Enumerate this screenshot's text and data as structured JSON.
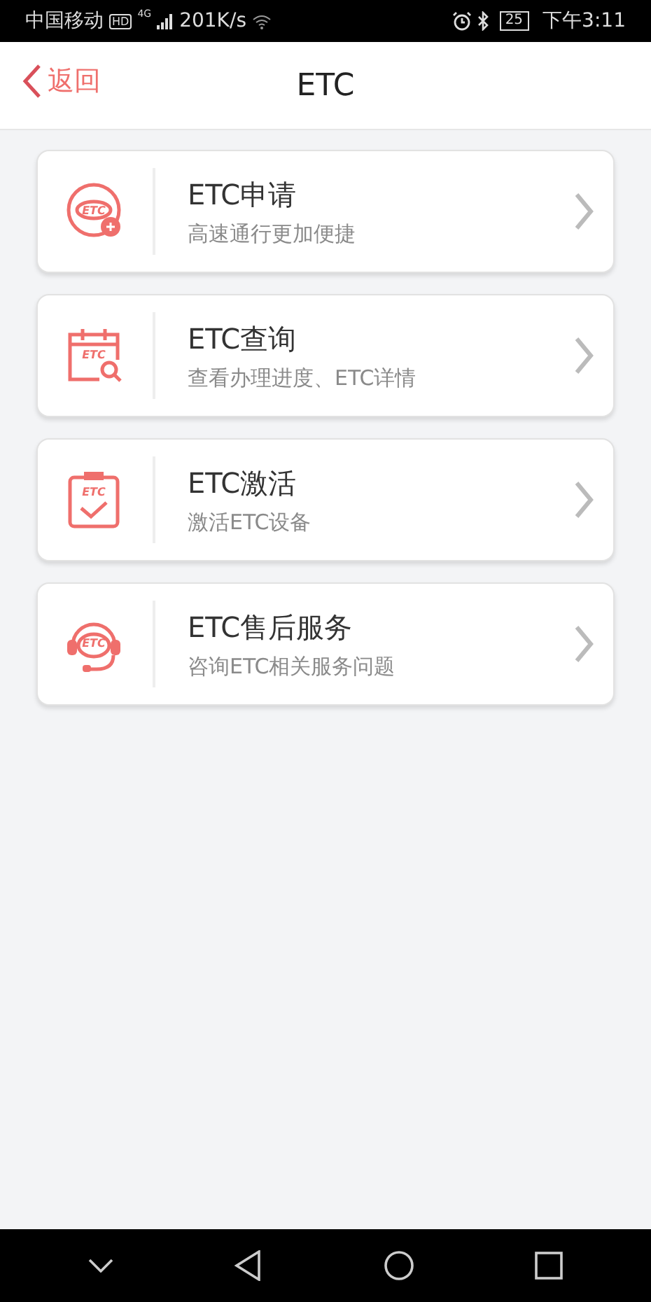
{
  "status_bar": {
    "carrier": "中国移动",
    "hd": "HD",
    "network": "4G",
    "speed": "201K/s",
    "battery": "25",
    "time": "下午3:11"
  },
  "header": {
    "back": "返回",
    "title": "ETC"
  },
  "items": [
    {
      "kind": "apply",
      "icon_label": "ETC",
      "title": "ETC申请",
      "subtitle": "高速通行更加便捷"
    },
    {
      "kind": "query",
      "icon_label": "ETC",
      "title": "ETC查询",
      "subtitle": "查看办理进度、ETC详情"
    },
    {
      "kind": "activate",
      "icon_label": "ETC",
      "title": "ETC激活",
      "subtitle": "激活ETC设备"
    },
    {
      "kind": "service",
      "icon_label": "ETC",
      "title": "ETC售后服务",
      "subtitle": "咨询ETC相关服务问题"
    }
  ]
}
